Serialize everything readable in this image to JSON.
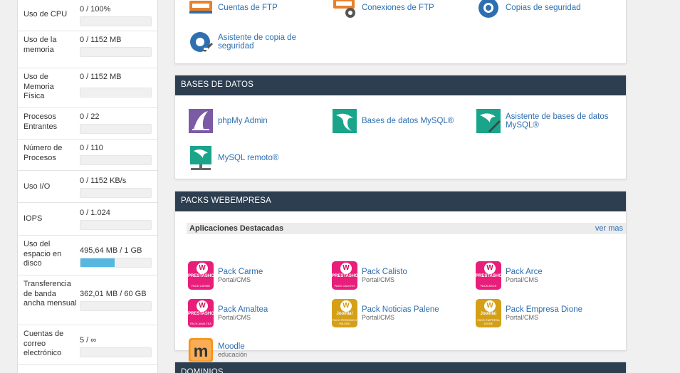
{
  "colors": {
    "header": "#2d3e50",
    "link": "#2e6fb1",
    "bar_fill": "#56b8e1",
    "pink": "#e91e7a",
    "gold": "#d4a017",
    "teal": "#1aa58a"
  },
  "stats": [
    {
      "label": "Uso de CPU",
      "value": "0 / 100%",
      "fill_pct": 0
    },
    {
      "label": "Uso de la memoria",
      "value": "0 / 1152 MB",
      "fill_pct": 0
    },
    {
      "label": "Uso de Memoria Física",
      "value": "0 / 1152 MB",
      "fill_pct": 0
    },
    {
      "label": "Procesos Entrantes",
      "value": "0 / 22",
      "fill_pct": 0
    },
    {
      "label": "Número de Procesos",
      "value": "0 / 110",
      "fill_pct": 0
    },
    {
      "label": "Uso I/O",
      "value": "0 / 1152 KB/s",
      "fill_pct": 0
    },
    {
      "label": "IOPS",
      "value": "0 / 1.024",
      "fill_pct": 0
    },
    {
      "label": "Uso del espacio en disco",
      "value": "495,64 MB / 1 GB",
      "fill_pct": 48
    },
    {
      "label": "Transferencia de banda ancha mensual",
      "value": "362,01 MB / 60 GB",
      "fill_pct": 0
    },
    {
      "label": "Cuentas de correo electrónico",
      "value": "5 / ∞",
      "fill_pct": 0
    }
  ],
  "files_panel": {
    "items": [
      {
        "label": "Cuentas de FTP",
        "icon": "ftp-accounts-icon"
      },
      {
        "label": "Conexiones de FTP",
        "icon": "ftp-connections-icon"
      },
      {
        "label": "Copias de seguridad",
        "icon": "backup-icon"
      },
      {
        "label": "Asistente de copia de seguridad",
        "icon": "backup-wizard-icon"
      }
    ]
  },
  "db_panel": {
    "title": "BASES DE DATOS",
    "items": [
      {
        "label": "phpMy Admin",
        "icon": "phpmyadmin-icon"
      },
      {
        "label": "Bases de datos MySQL®",
        "icon": "mysql-databases-icon"
      },
      {
        "label": "Asistente de bases de datos MySQL®",
        "icon": "mysql-wizard-icon"
      },
      {
        "label": "MySQL remoto®",
        "icon": "remote-mysql-icon"
      }
    ]
  },
  "packs_panel": {
    "title": "PACKS WEBEMPRESA",
    "apps_header": "Aplicaciones Destacadas",
    "more_link": "ver mas",
    "items": [
      {
        "label": "Pack Carme",
        "sub": "Portal/CMS",
        "icon": "prestashop-pack-icon",
        "badge": "PRESTASHOP",
        "badge_bottom": "PACK CARME"
      },
      {
        "label": "Pack Calisto",
        "sub": "Portal/CMS",
        "icon": "prestashop-pack-icon",
        "badge": "PRESTASHOP",
        "badge_bottom": "PACK CALISTO"
      },
      {
        "label": "Pack Arce",
        "sub": "Portal/CMS",
        "icon": "prestashop-pack-icon",
        "badge": "PRESTASHOP",
        "badge_bottom": "PACK ARCE"
      },
      {
        "label": "Pack Amaltea",
        "sub": "Portal/CMS",
        "icon": "prestashop-pack-icon",
        "badge": "PRESTASHOP",
        "badge_bottom": "PACK AMALTEA"
      },
      {
        "label": "Pack Noticias Palene",
        "sub": "Portal/CMS",
        "icon": "joomla-pack-icon",
        "badge": "Joomla!",
        "badge_bottom": "PACK PERIODICO PALENE"
      },
      {
        "label": "Pack Empresa Dione",
        "sub": "Portal/CMS",
        "icon": "joomla-pack-icon",
        "badge": "Joomla!",
        "badge_bottom": "PACK EMPRESA DIONE"
      },
      {
        "label": "Moodle",
        "sub": "educación",
        "icon": "moodle-icon"
      }
    ]
  },
  "domains_panel": {
    "title": "DOMINIOS"
  }
}
